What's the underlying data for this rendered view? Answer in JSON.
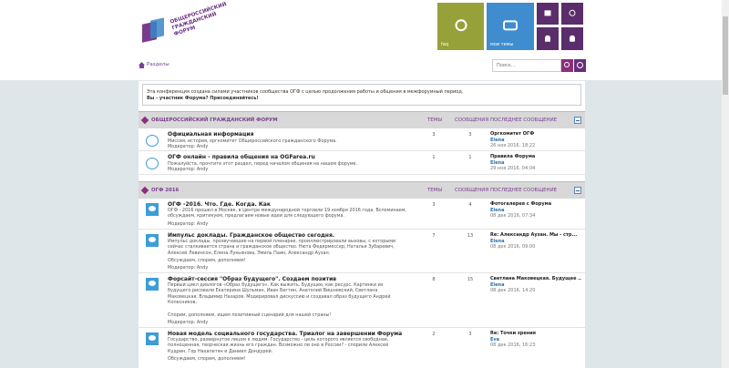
{
  "logo": {
    "lines": "ОБЩЕРОССИЙСКИЙ ГРАЖДАНСКИЙ ФОРУМ"
  },
  "tiles": {
    "faq": "faq",
    "my_topics": "мои темы"
  },
  "nav": {
    "breadcrumb": "Разделы",
    "search_placeholder": "Поиск…"
  },
  "notice": {
    "line1": "Эта конференция создана силами участников сообщества ОГФ с целью продолжения работы и общения в межфорумный период.",
    "line2": "Вы - участник Форума? Присоединяйтесь!"
  },
  "columns": {
    "topics": "ТЕМЫ",
    "posts": "СООБЩЕНИЯ",
    "last_post": "ПОСЛЕДНЕЕ СООБЩЕНИЕ"
  },
  "categories": [
    {
      "name": "ОБЩЕРОССИЙСКИЙ ГРАЖДАНСКИЙ ФОРУМ",
      "forums": [
        {
          "title": "Официальная информация",
          "desc": "Миссия, история, оргкомитет Общероссийского гражданского Форума.",
          "mod": "Модератор: Andy",
          "topics": "3",
          "posts": "3",
          "lp_title": "Оргкомитет ОГФ",
          "lp_user": "Elena",
          "lp_date": "26 ноя 2016, 18:22"
        },
        {
          "title": "ОГФ онлайн - правила общения на OGFarea.ru",
          "desc": "Пожалуйста, прочтите этот раздел, перед началом общения на нашем форуме.",
          "mod": "Модератор: Andy",
          "topics": "1",
          "posts": "1",
          "lp_title": "Правила Форума",
          "lp_user": "Elena",
          "lp_date": "29 ноя 2016, 04:04"
        }
      ]
    },
    {
      "name": "ОГФ 2016",
      "forums": [
        {
          "title": "ОГФ -2016. Что. Где. Когда. Как",
          "desc": "ОГФ - 2016 прошел в Москве, в Центре международной торговли 19 ноября 2016 года. Вспоминаем, обсуждаем, критикуем, предлагаем новые идеи для следующего форума.",
          "mod": "Модератор: Andy",
          "topics": "3",
          "posts": "4",
          "lp_title": "Фотогалерея с Форума",
          "lp_user": "Elena",
          "lp_date": "08 дек 2016, 07:34"
        },
        {
          "title": "Импульс доклады. Гражданское общество сегодня.",
          "desc": "Импульс доклады, прозвучавшие на первой пленарке, проиллюстрировали вызовы, с которыми сейчас сталкивается страна и гражданское общество. Нюта Федермессер, Наталья Зубаревич, Алексей Левинсон, Елена Лукьянова, Эмиль Паин, Александр Аузан.",
          "mod2": "Обсуждаем, спорим, дополняем!",
          "mod": "Модератор: Andy",
          "topics": "7",
          "posts": "13",
          "lp_title": "Re: Александр Аузан. Мы - стр...",
          "lp_user": "Elena",
          "lp_date": "08 дек 2016, 09:00"
        },
        {
          "title": "Форсайт-сессия \"Образ будущего\". Создаем позитив",
          "desc": "Первый цикл диалогов «Образ будущего». Как выжить. Будущее, как ресурс. Картинки из будущего рисовали Екатерина Шульман, Иван Бегтин, Анатолий Вишневский, Светлана Маковецкая, Владимир Назаров. Модерировал дискуссию и создавал образ будущего Андрей Колесников.",
          "mod2": "Спорим, дополняем, ищем позитивный сценарий для нашей страны!",
          "mod": "Модератор: Andy",
          "topics": "8",
          "posts": "15",
          "lp_title": "Светлана Маковецкая. Будущее ...",
          "lp_user": "Elena",
          "lp_date": "08 дек 2016, 14:20"
        },
        {
          "title": "Новая модель социального государства. Триалог на завершении Форума",
          "desc": "Государство, развернутое лицом к людям. Государство - цель которого является свободная, полноценная, творческая жизнь его граждан. Возможно ли оно в России? - спорили Алексей Кудрин, Гор Нахапетян и Даниил Дондурей.",
          "mod2": "Обсуждаем, спорим, дополняем!",
          "mod": "",
          "topics": "2",
          "posts": "3",
          "lp_title": "Re: Точки зрения",
          "lp_user": "Eva",
          "lp_date": "08 дек 2016, 16:23"
        }
      ]
    }
  ]
}
